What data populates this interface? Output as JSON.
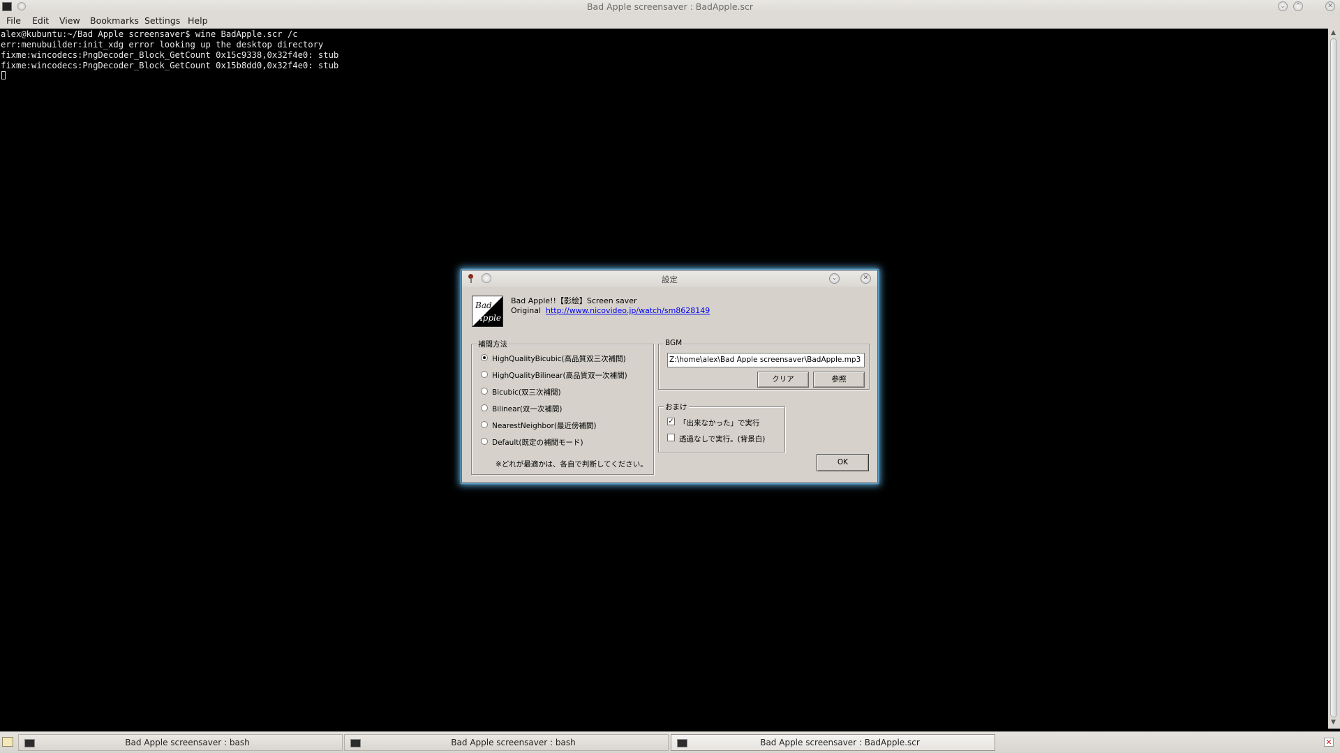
{
  "window": {
    "title": "Bad Apple screensaver : BadApple.scr",
    "controls": {
      "minimize": "⌄",
      "maximize": "⌃",
      "close": "✕"
    }
  },
  "menubar": {
    "items": [
      "File",
      "Edit",
      "View",
      "Bookmarks",
      "Settings",
      "Help"
    ]
  },
  "terminal": {
    "lines": [
      "alex@kubuntu:~/Bad Apple screensaver$ wine BadApple.scr /c",
      "err:menubuilder:init_xdg error looking up the desktop directory",
      "fixme:wincodecs:PngDecoder_Block_GetCount 0x15c9338,0x32f4e0: stub",
      "fixme:wincodecs:PngDecoder_Block_GetCount 0x15b8dd0,0x32f4e0: stub"
    ]
  },
  "scrollbar": {
    "up_arrow": "▲",
    "down_arrow": "▼"
  },
  "dialog": {
    "title": "設定",
    "controls": {
      "minimize": "⌄",
      "close": "✕"
    },
    "logo_text": [
      "Bad",
      "Apple"
    ],
    "app_title": "Bad Apple!!【影絵】Screen saver",
    "original_label": "Original",
    "original_url": "http://www.nicovideo.jp/watch/sm8628149",
    "interpolation": {
      "legend": "補間方法",
      "options": [
        "HighQualityBicubic(高品質双三次補間)",
        "HighQualityBilinear(高品質双一次補間)",
        "Bicubic(双三次補間)",
        "Bilinear(双一次補間)",
        "NearestNeighbor(最近傍補間)",
        "Default(既定の補間モード)"
      ],
      "selected_index": 0,
      "note": "※どれが最適かは、各自で判断してください。"
    },
    "bgm": {
      "legend": "BGM",
      "path": "Z:\\home\\alex\\Bad Apple screensaver\\BadApple.mp3",
      "clear_label": "クリア",
      "browse_label": "参照"
    },
    "omake": {
      "legend": "おまけ",
      "options": [
        {
          "label": "「出来なかった」で実行",
          "checked": true
        },
        {
          "label": "透過なしで実行。(背景白)",
          "checked": false
        }
      ]
    },
    "ok_label": "OK"
  },
  "taskbar": {
    "tasks": [
      {
        "label": "Bad Apple screensaver : bash",
        "active": false
      },
      {
        "label": "Bad Apple screensaver : bash",
        "active": false
      },
      {
        "label": "Bad Apple screensaver : BadApple.scr",
        "active": true
      }
    ],
    "tray_icon_glyph": "✕"
  }
}
